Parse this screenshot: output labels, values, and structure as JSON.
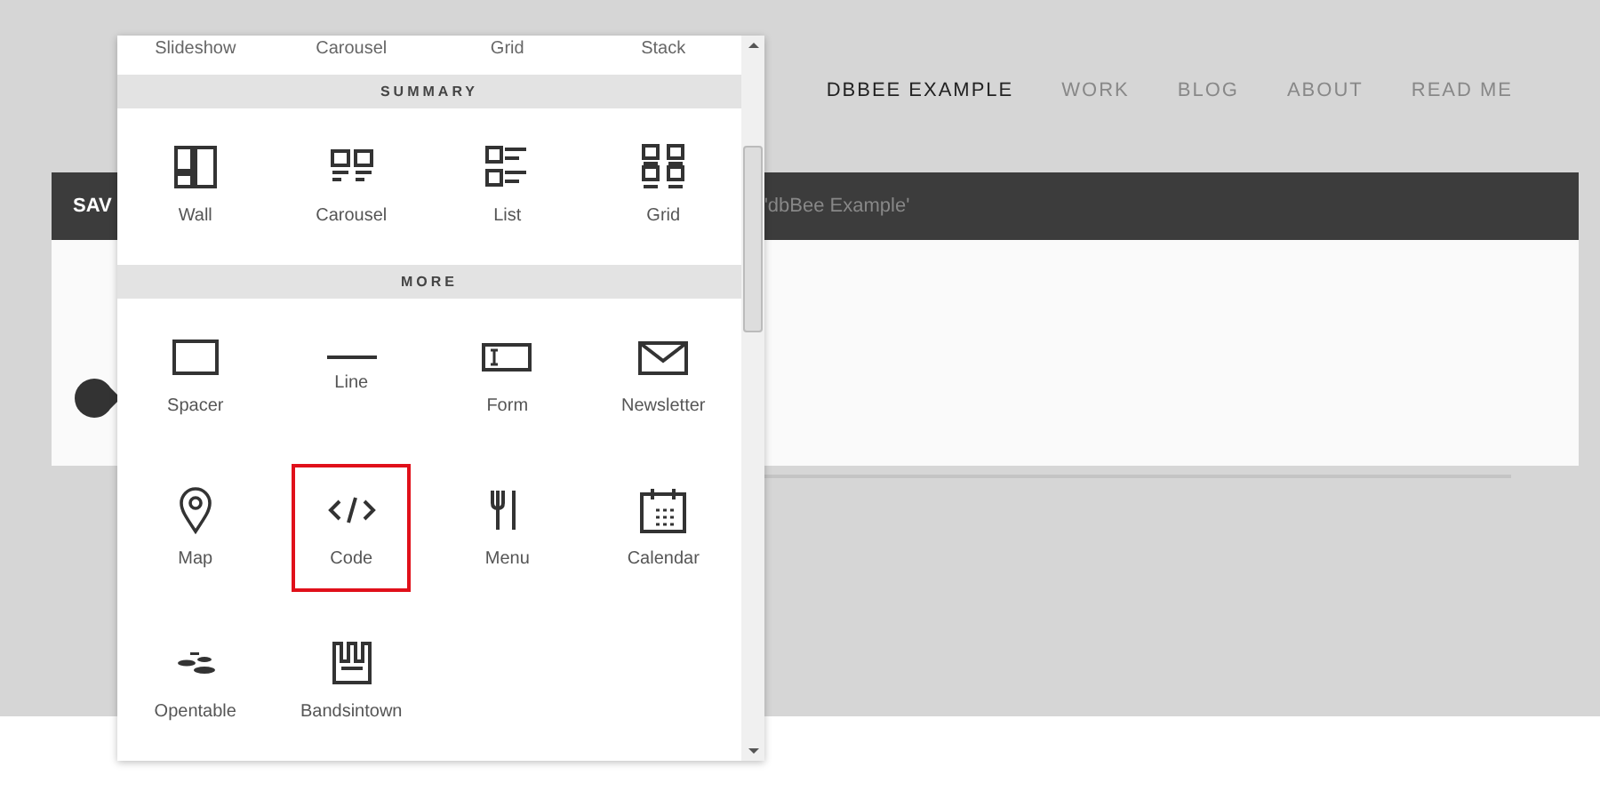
{
  "nav": [
    {
      "label": "DBBEE EXAMPLE",
      "selected": true
    },
    {
      "label": "WORK",
      "selected": false
    },
    {
      "label": "BLOG",
      "selected": false
    },
    {
      "label": "ABOUT",
      "selected": false
    },
    {
      "label": "READ ME",
      "selected": false
    }
  ],
  "editor_bar": {
    "button": "SAV",
    "title": "'dbBee Example'"
  },
  "block_menu": {
    "top_row": [
      "Slideshow",
      "Carousel",
      "Grid",
      "Stack"
    ],
    "sections": [
      {
        "title": "SUMMARY",
        "items": [
          {
            "label": "Wall",
            "kind": "wall",
            "selected": false
          },
          {
            "label": "Carousel",
            "kind": "carousel",
            "selected": false
          },
          {
            "label": "List",
            "kind": "list",
            "selected": false
          },
          {
            "label": "Grid",
            "kind": "grid",
            "selected": false
          }
        ]
      },
      {
        "title": "MORE",
        "items": [
          {
            "label": "Spacer",
            "kind": "spacer",
            "selected": false
          },
          {
            "label": "Line",
            "kind": "line",
            "selected": false
          },
          {
            "label": "Form",
            "kind": "form",
            "selected": false
          },
          {
            "label": "Newsletter",
            "kind": "newsletter",
            "selected": false
          },
          {
            "label": "Map",
            "kind": "map",
            "selected": false
          },
          {
            "label": "Code",
            "kind": "code",
            "selected": true
          },
          {
            "label": "Menu",
            "kind": "menu",
            "selected": false
          },
          {
            "label": "Calendar",
            "kind": "calendar",
            "selected": false
          },
          {
            "label": "Opentable",
            "kind": "opentable",
            "selected": false
          },
          {
            "label": "Bandsintown",
            "kind": "bandsintown",
            "selected": false
          }
        ]
      }
    ]
  }
}
